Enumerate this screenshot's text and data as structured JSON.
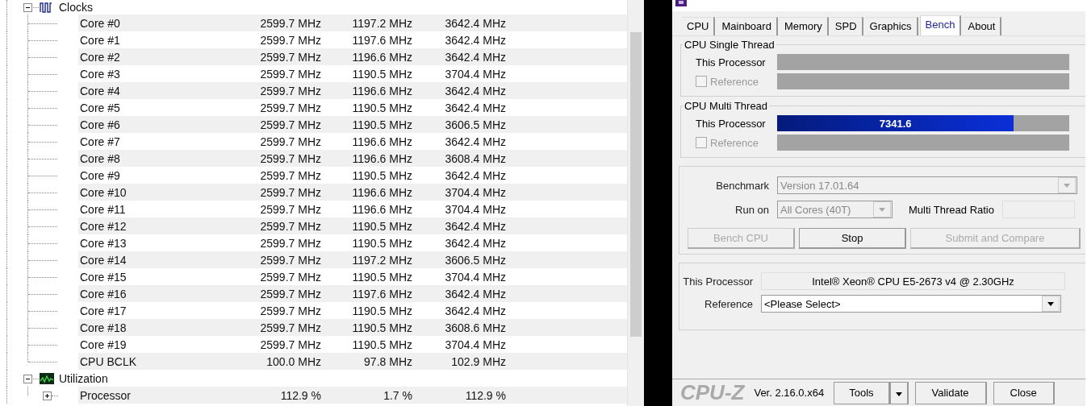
{
  "sensor_tree": {
    "groups": [
      {
        "label": "Clocks",
        "kind": "clocks",
        "expanded": true,
        "rows": [
          {
            "name": "Core #0",
            "kind": "leaf",
            "values": [
              "2599.7 MHz",
              "1197.2 MHz",
              "3642.4 MHz"
            ]
          },
          {
            "name": "Core #1",
            "kind": "leaf",
            "values": [
              "2599.7 MHz",
              "1197.6 MHz",
              "3642.4 MHz"
            ]
          },
          {
            "name": "Core #2",
            "kind": "leaf",
            "values": [
              "2599.7 MHz",
              "1196.6 MHz",
              "3642.4 MHz"
            ]
          },
          {
            "name": "Core #3",
            "kind": "leaf",
            "values": [
              "2599.7 MHz",
              "1190.5 MHz",
              "3704.4 MHz"
            ]
          },
          {
            "name": "Core #4",
            "kind": "leaf",
            "values": [
              "2599.7 MHz",
              "1196.6 MHz",
              "3642.4 MHz"
            ]
          },
          {
            "name": "Core #5",
            "kind": "leaf",
            "values": [
              "2599.7 MHz",
              "1190.5 MHz",
              "3642.4 MHz"
            ]
          },
          {
            "name": "Core #6",
            "kind": "leaf",
            "values": [
              "2599.7 MHz",
              "1190.5 MHz",
              "3606.5 MHz"
            ]
          },
          {
            "name": "Core #7",
            "kind": "leaf",
            "values": [
              "2599.7 MHz",
              "1196.6 MHz",
              "3642.4 MHz"
            ]
          },
          {
            "name": "Core #8",
            "kind": "leaf",
            "values": [
              "2599.7 MHz",
              "1196.6 MHz",
              "3608.4 MHz"
            ]
          },
          {
            "name": "Core #9",
            "kind": "leaf",
            "values": [
              "2599.7 MHz",
              "1190.5 MHz",
              "3642.4 MHz"
            ]
          },
          {
            "name": "Core #10",
            "kind": "leaf",
            "values": [
              "2599.7 MHz",
              "1196.6 MHz",
              "3704.4 MHz"
            ]
          },
          {
            "name": "Core #11",
            "kind": "leaf",
            "values": [
              "2599.7 MHz",
              "1196.6 MHz",
              "3704.4 MHz"
            ]
          },
          {
            "name": "Core #12",
            "kind": "leaf",
            "values": [
              "2599.7 MHz",
              "1190.5 MHz",
              "3642.4 MHz"
            ]
          },
          {
            "name": "Core #13",
            "kind": "leaf",
            "values": [
              "2599.7 MHz",
              "1190.5 MHz",
              "3642.4 MHz"
            ]
          },
          {
            "name": "Core #14",
            "kind": "leaf",
            "values": [
              "2599.7 MHz",
              "1197.2 MHz",
              "3606.5 MHz"
            ]
          },
          {
            "name": "Core #15",
            "kind": "leaf",
            "values": [
              "2599.7 MHz",
              "1190.5 MHz",
              "3704.4 MHz"
            ]
          },
          {
            "name": "Core #16",
            "kind": "leaf",
            "values": [
              "2599.7 MHz",
              "1197.6 MHz",
              "3642.4 MHz"
            ]
          },
          {
            "name": "Core #17",
            "kind": "leaf",
            "values": [
              "2599.7 MHz",
              "1190.5 MHz",
              "3642.4 MHz"
            ]
          },
          {
            "name": "Core #18",
            "kind": "leaf",
            "values": [
              "2599.7 MHz",
              "1190.5 MHz",
              "3608.6 MHz"
            ]
          },
          {
            "name": "Core #19",
            "kind": "leaf",
            "values": [
              "2599.7 MHz",
              "1190.5 MHz",
              "3704.4 MHz"
            ]
          },
          {
            "name": "CPU BCLK",
            "kind": "leaf",
            "values": [
              "100.0 MHz",
              "97.8 MHz",
              "102.9 MHz"
            ]
          }
        ]
      },
      {
        "label": "Utilization",
        "kind": "utilization",
        "expanded": true,
        "rows": [
          {
            "name": "Processor",
            "kind": "node",
            "expanded": false,
            "values": [
              "112.9 %",
              "1.7 %",
              "112.9 %"
            ]
          }
        ]
      }
    ]
  },
  "cpuz": {
    "tabs": [
      {
        "label": "CPU",
        "selected": false
      },
      {
        "label": "Mainboard",
        "selected": false
      },
      {
        "label": "Memory",
        "selected": false
      },
      {
        "label": "SPD",
        "selected": false
      },
      {
        "label": "Graphics",
        "selected": false
      },
      {
        "label": "Bench",
        "selected": true
      },
      {
        "label": "About",
        "selected": false
      }
    ],
    "bench_groups": [
      {
        "title": "CPU Single Thread",
        "processor_label": "This Processor",
        "level": 0,
        "reference_label": "Reference",
        "reference_checked": false
      },
      {
        "title": "CPU Multi Thread",
        "processor_label": "This Processor",
        "level": 0.81,
        "score": "7341.6",
        "reference_label": "Reference",
        "reference_checked": false
      }
    ],
    "benchmark": {
      "label": "Benchmark",
      "value": "Version 17.01.64",
      "disabled": true
    },
    "run_on": {
      "label": "Run on",
      "value": "All Cores (40T)",
      "disabled": true
    },
    "ratio": {
      "label": "Multi Thread Ratio"
    },
    "actions": [
      {
        "label": "Bench CPU",
        "disabled": true
      },
      {
        "label": "Stop",
        "disabled": false
      },
      {
        "label": "Submit and Compare",
        "disabled": true
      }
    ],
    "this_processor": {
      "label": "This Processor",
      "value": "Intel® Xeon® CPU E5-2673 v4 @ 2.30GHz"
    },
    "reference": {
      "label": "Reference",
      "value": "<Please Select>"
    },
    "footer": {
      "logo": "CPU-Z",
      "version": "Ver. 2.16.0.x64",
      "tools": "Tools",
      "buttons": [
        "Validate",
        "Close"
      ]
    }
  }
}
